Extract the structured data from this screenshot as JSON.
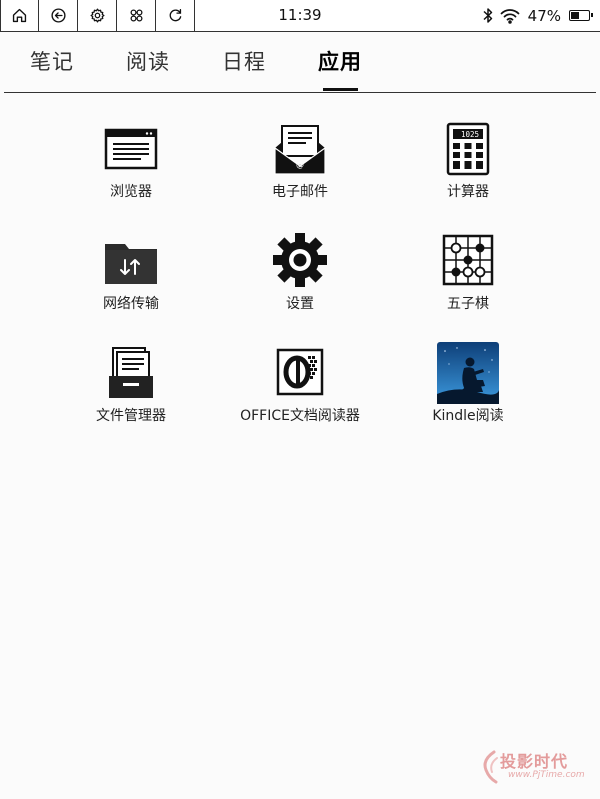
{
  "status_bar": {
    "time": "11:39",
    "battery_percent_text": "47%",
    "battery_level": 0.47,
    "buttons": [
      "home-icon",
      "back-icon",
      "settings-gear-icon",
      "apps-icon",
      "refresh-icon"
    ],
    "indicators": [
      "bluetooth-icon",
      "wifi-icon",
      "battery-icon"
    ]
  },
  "tabs": [
    {
      "label": "笔记",
      "active": false
    },
    {
      "label": "阅读",
      "active": false
    },
    {
      "label": "日程",
      "active": false
    },
    {
      "label": "应用",
      "active": true
    }
  ],
  "apps": [
    {
      "label": "浏览器",
      "icon": "browser-icon"
    },
    {
      "label": "电子邮件",
      "icon": "email-icon"
    },
    {
      "label": "计算器",
      "icon": "calculator-icon",
      "display": "1025"
    },
    {
      "label": "网络传输",
      "icon": "network-transfer-folder-icon"
    },
    {
      "label": "设置",
      "icon": "settings-gear-icon"
    },
    {
      "label": "五子棋",
      "icon": "gomoku-board-icon"
    },
    {
      "label": "文件管理器",
      "icon": "file-manager-icon"
    },
    {
      "label": "OFFICE文档阅读器",
      "icon": "office-reader-icon"
    },
    {
      "label": "Kindle阅读",
      "icon": "kindle-reader-icon"
    }
  ],
  "watermark": {
    "main": "投影时代",
    "sub": "www.PjTime.com"
  },
  "colors": {
    "ink": "#111111",
    "background": "#fbfbfb",
    "kindle_sky": "#1d6fb8",
    "watermark": "#e39b9b"
  }
}
